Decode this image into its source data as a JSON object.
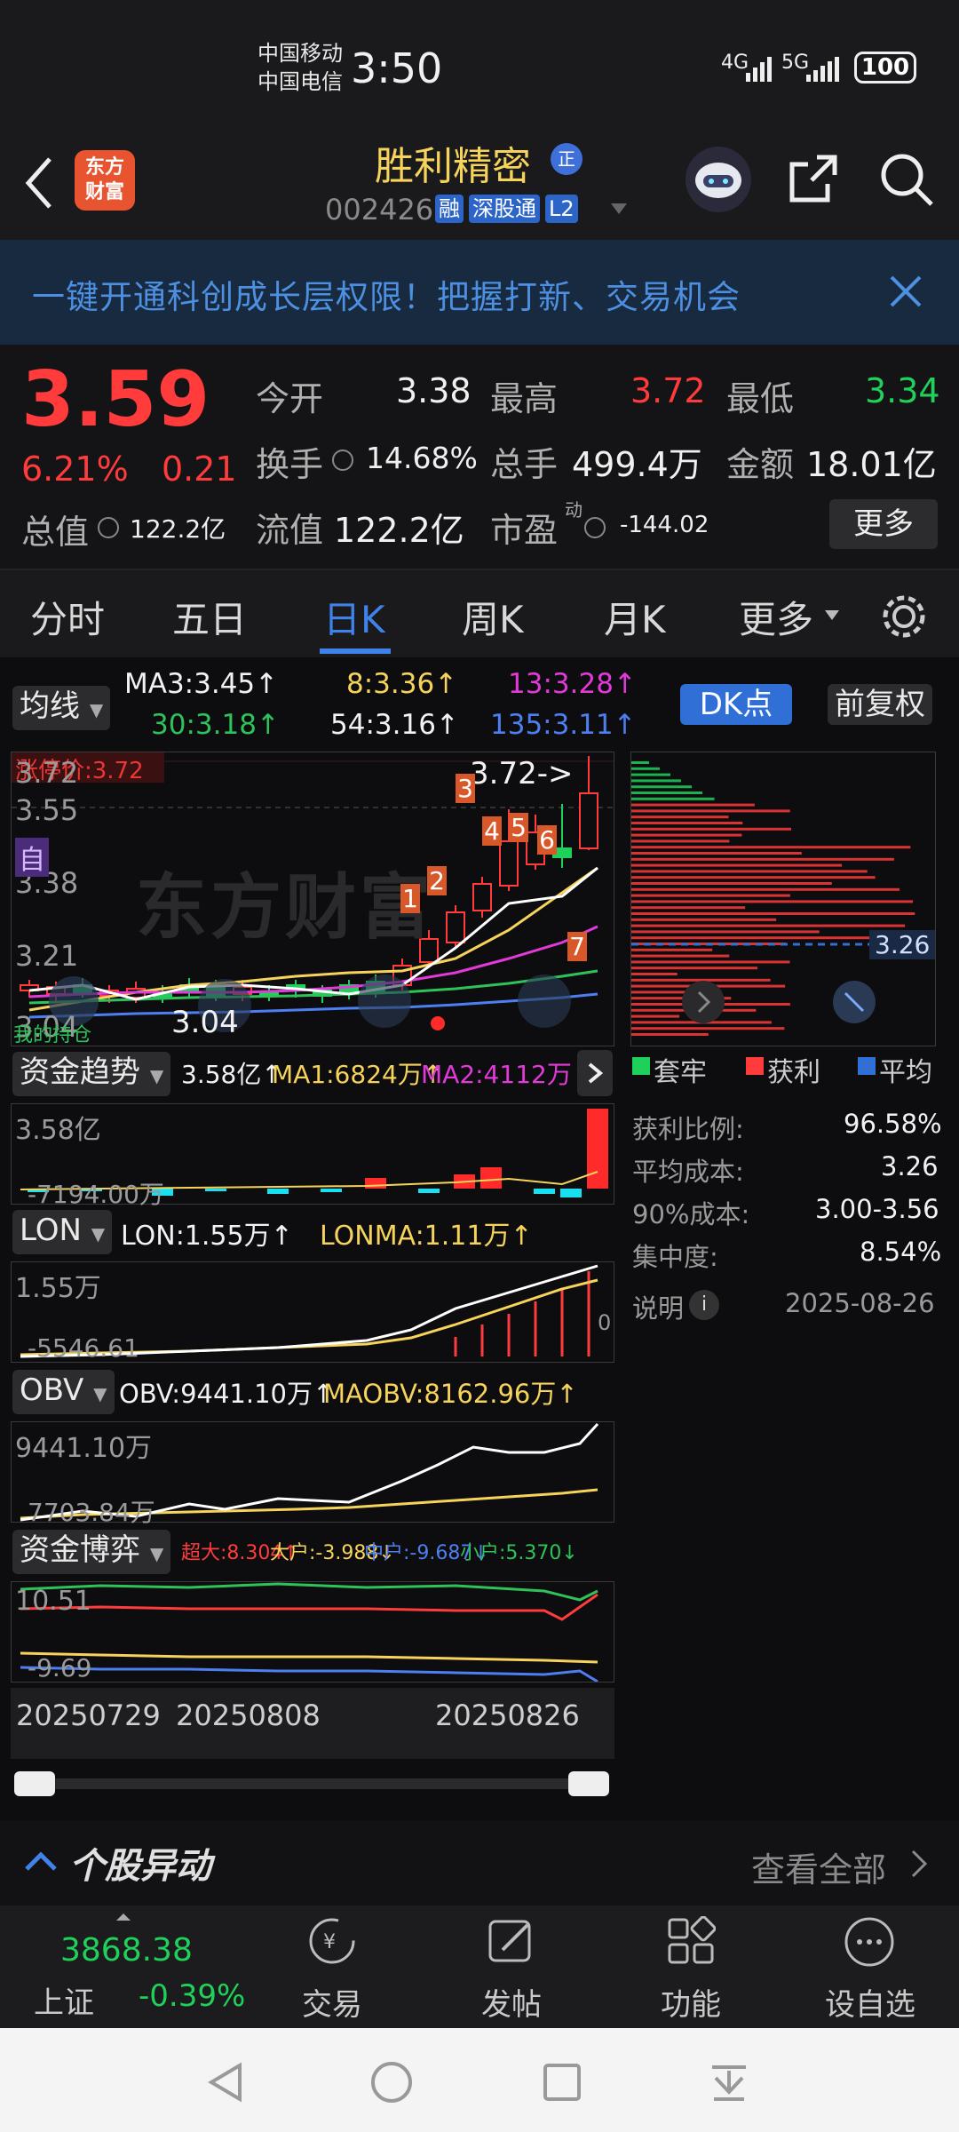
{
  "status_bar": {
    "carrier1": "中国移动",
    "carrier2": "中国电信",
    "time": "3:50",
    "signal1": "4G",
    "signal2": "5G",
    "battery": "100"
  },
  "header": {
    "logo_line1": "东方",
    "logo_line2": "财富",
    "stock_name": "胜利精密",
    "name_badge": "正",
    "code": "002426",
    "tags": [
      "融",
      "深股通",
      "L2"
    ]
  },
  "banner": {
    "text": "一键开通科创成长层权限！把握打新、交易机会"
  },
  "quote": {
    "price": "3.59",
    "change_pct": "6.21%",
    "change": "0.21",
    "open_label": "今开",
    "open": "3.38",
    "high_label": "最高",
    "high": "3.72",
    "low_label": "最低",
    "low": "3.34",
    "turnover_label": "换手",
    "turnover": "14.68%",
    "volume_label": "总手",
    "volume": "499.4万",
    "amount_label": "金额",
    "amount": "18.01亿",
    "mcap_label": "总值",
    "mcap": "122.2亿",
    "float_label": "流值",
    "float": "122.2亿",
    "pe_label": "市盈",
    "pe_sup": "动",
    "pe": "-144.02",
    "more": "更多"
  },
  "tabs": [
    "分时",
    "五日",
    "日K",
    "周K",
    "月K",
    "更多"
  ],
  "active_tab": "日K",
  "ma_bar": {
    "selector": "均线",
    "ma3": "MA3:3.45↑",
    "ma8": "8:3.36↑",
    "ma13": "13:3.28↑",
    "ma30": "30:3.18↑",
    "ma54": "54:3.16↑",
    "ma135": "135:3.11↑",
    "dk": "DK点",
    "fq": "前复权"
  },
  "kline": {
    "y_labels": [
      "3.72",
      "3.55",
      "3.38",
      "3.21",
      "3.04"
    ],
    "limit_label": "涨停价:3.72",
    "high_annotation": "3.72->",
    "low_annotation": "3.04",
    "self_tag": "自",
    "markers": [
      "1",
      "2",
      "3",
      "4",
      "5",
      "6",
      "7"
    ],
    "watermark": "东方财富",
    "bottom_tag": "我的持仓"
  },
  "chip": {
    "avg_cost_tag": "3.26",
    "legend": [
      "套牢",
      "获利",
      "平均"
    ],
    "profit_ratio_label": "获利比例:",
    "profit_ratio": "96.58%",
    "avg_cost_label": "平均成本:",
    "avg_cost": "3.26",
    "cost90_label": "90%成本:",
    "cost90": "3.00-3.56",
    "concentration_label": "集中度:",
    "concentration": "8.54%",
    "note_label": "说明",
    "date": "2025-08-26"
  },
  "fund_trend": {
    "selector": "资金趋势",
    "value": "3.58亿↑",
    "ma1": "MA1:6824万↑",
    "ma2": "MA2:4112万↑",
    "y_top": "3.58亿",
    "y_bottom": "-7194.00万"
  },
  "lon": {
    "selector": "LON",
    "lon": "LON:1.55万↑",
    "lonma": "LONMA:1.11万↑",
    "y_top": "1.55万",
    "y_bottom": "-5546.61",
    "zero": "0"
  },
  "obv": {
    "selector": "OBV",
    "obv": "OBV:9441.10万↑",
    "maobv": "MAOBV:8162.96万↑",
    "y_top": "9441.10万",
    "y_bottom": "7703.84万"
  },
  "game": {
    "selector": "资金博弈",
    "super": "超大:8.304↑",
    "big": "大户:-3.988↓",
    "mid": "中户:-9.687↓",
    "small": "小户:5.370↓",
    "y_top": "10.51",
    "y_bottom": "-9.69"
  },
  "dates": [
    "20250729",
    "20250808",
    "20250826"
  ],
  "movement": {
    "title": "个股异动",
    "view_all": "查看全部"
  },
  "index": {
    "value": "3868.38",
    "name": "上证",
    "change": "-0.39%"
  },
  "nav": [
    "交易",
    "发帖",
    "功能",
    "设自选"
  ],
  "colors": {
    "up": "#ff3b3b",
    "down": "#1fd15a",
    "accent": "#2f6fd6",
    "yellow": "#f6d35b"
  }
}
